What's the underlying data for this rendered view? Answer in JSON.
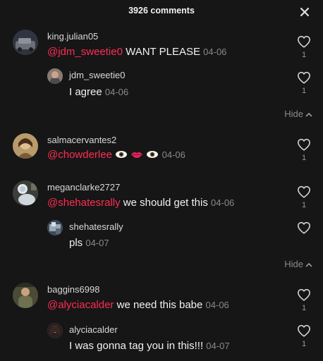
{
  "header": {
    "title": "3926 comments"
  },
  "comments": [
    {
      "username": "king.julian05",
      "mention": "@jdm_sweetie0",
      "text": " WANT PLEASE ",
      "date": "04-06",
      "likes": "1",
      "replies": [
        {
          "username": "jdm_sweetie0",
          "text": "I agree ",
          "date": "04-06",
          "likes": "1"
        }
      ],
      "hide_label": "Hide"
    },
    {
      "username": "salmacervantes2",
      "mention": "@chowderlee",
      "text": " ",
      "emoji_icons": [
        "eye-emoji",
        "lips-emoji",
        "eye-emoji"
      ],
      "date": "04-06",
      "likes": "1"
    },
    {
      "username": "meganclarke2727",
      "mention": "@shehatesrally",
      "text": " we should get this ",
      "date": "04-06",
      "likes": "1",
      "replies": [
        {
          "username": "shehatesrally",
          "text": "pls ",
          "date": "04-07",
          "likes": ""
        }
      ],
      "hide_label": "Hide"
    },
    {
      "username": "baggins6998",
      "mention": "@alyciacalder",
      "text": " we need this babe ",
      "date": "04-06",
      "likes": "1",
      "replies": [
        {
          "username": "alyciacalder",
          "text": "I was gonna tag you in this!!! ",
          "date": "04-07",
          "likes": "1"
        }
      ]
    }
  ],
  "icons": {
    "close": "close-icon",
    "like": "heart-outline-icon",
    "hide": "chevron-up-icon"
  },
  "colors": {
    "background": "#161616",
    "mention": "#fe2c55",
    "secondary_text": "#8a8a8a"
  }
}
